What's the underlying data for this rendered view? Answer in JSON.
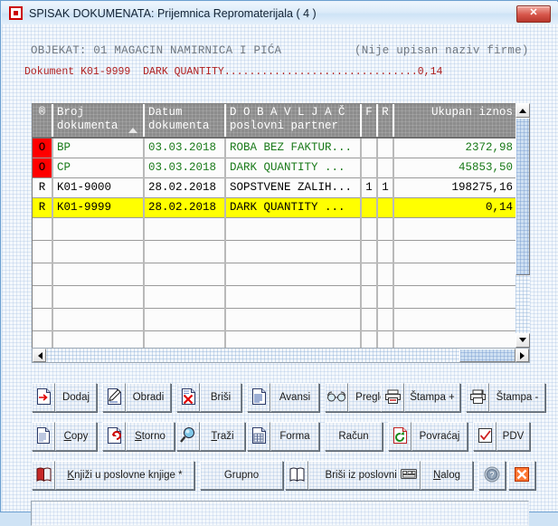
{
  "window": {
    "title_bold": "SPISAK DOKUMENATA:",
    "title_rest": "Prijemnica Repromaterijala  ( 4 )",
    "close_label": "✕",
    "app_icon": "red-square-icon"
  },
  "header": {
    "objekat": "OBJEKAT: 01 MAGACIN NAMIRNICA I PIĆA",
    "firm_note": "(Nije upisan naziv firme)",
    "document_line": "Dokument K01-9999  DARK QUANTITY...............................0,14",
    "document_color": "#b02020"
  },
  "grid": {
    "columns": [
      {
        "id": "flag",
        "label": "®",
        "label2": "",
        "align": "center"
      },
      {
        "id": "broj",
        "label": "Broj",
        "label2": "dokumenta",
        "align": "left",
        "sorted": true
      },
      {
        "id": "datum",
        "label": "Datum",
        "label2": "dokumenta",
        "align": "left"
      },
      {
        "id": "dob",
        "label": "D O B A V L J A Č",
        "label2": "poslovni partner",
        "align": "left"
      },
      {
        "id": "f",
        "label": "F",
        "label2": "",
        "align": "center"
      },
      {
        "id": "r",
        "label": "R",
        "label2": "",
        "align": "center"
      },
      {
        "id": "iznos",
        "label": "Ukupan iznos",
        "label2": "",
        "align": "right"
      }
    ],
    "rows": [
      {
        "flag": "O",
        "flag_bg": "#ff0000",
        "broj": "BP",
        "datum": "03.03.2018",
        "dob": "ROBA BEZ FAKTUR...",
        "f": "",
        "r": "",
        "iznos": "2372,98",
        "text_color": "#1a7a1a",
        "selected": false
      },
      {
        "flag": "O",
        "flag_bg": "#ff0000",
        "broj": "CP",
        "datum": "03.03.2018",
        "dob": "DARK QUANTITY   ...",
        "f": "",
        "r": "",
        "iznos": "45853,50",
        "text_color": "#1a7a1a",
        "selected": false
      },
      {
        "flag": "R",
        "flag_bg": "",
        "broj": "K01-9000",
        "datum": "28.02.2018",
        "dob": "SOPSTVENE ZALIH...",
        "f": "1",
        "r": "1",
        "iznos": "198275,16",
        "text_color": "#000000",
        "selected": false
      },
      {
        "flag": "R",
        "flag_bg": "#ffff00",
        "broj": "K01-9999",
        "datum": "28.02.2018",
        "dob": "DARK QUANTITY   ...",
        "f": "",
        "r": "",
        "iznos": "0,14",
        "text_color": "#000000",
        "selected": true
      }
    ],
    "empty_row_count": 7,
    "selection_color": "#ffff00"
  },
  "scrollbars": {
    "vertical": {
      "up_arrow": "▲",
      "down_arrow": "▼",
      "thumb_top_pct": 0,
      "thumb_size_pct": 73
    },
    "horizontal": {
      "left_arrow": "◄",
      "right_arrow": "►",
      "thumb_left_pct": 88,
      "thumb_size_pct": 12
    }
  },
  "toolbar": {
    "rows": [
      [
        {
          "icon": "document-add-icon",
          "label": "Dodaj",
          "accel": ""
        },
        {
          "icon": "document-edit-icon",
          "label": "Obradi",
          "accel": ""
        },
        {
          "icon": "document-delete-icon",
          "label": "Briši",
          "accel": ""
        },
        {
          "icon": "document-list-icon",
          "label": "Avansi",
          "accel": ""
        },
        {
          "icon": "glasses-icon",
          "label": "Pregled",
          "accel": ""
        },
        {
          "icon": "printer-plus-icon",
          "label": "Štampa +",
          "accel": ""
        },
        {
          "icon": "printer-minus-icon",
          "label": "Štampa -",
          "accel": ""
        }
      ],
      [
        {
          "icon": "document-copy-icon",
          "label": "Copy",
          "accel": "C"
        },
        {
          "icon": "document-undo-icon",
          "label": "Storno",
          "accel": "S"
        },
        {
          "icon": "magnifier-icon",
          "label": "Traži",
          "accel": "T"
        },
        {
          "icon": "form-icon",
          "label": "Forma",
          "accel": ""
        },
        {
          "icon": "",
          "label": "Račun",
          "accel": ""
        },
        {
          "icon": "document-refresh-icon",
          "label": "Povraćaj",
          "accel": ""
        },
        {
          "icon": "checkbox-check-icon",
          "label": "PDV",
          "accel": ""
        }
      ],
      [
        {
          "icon": "book-red-icon",
          "label": "Knjiži u poslovne knjige *",
          "accel": "K"
        },
        {
          "icon": "",
          "label": "Grupno",
          "accel": ""
        },
        {
          "icon": "book-open-icon",
          "label": "Briši iz poslovnih knjiga",
          "accel": ""
        },
        {
          "icon": "keyboard-icon",
          "label": "Nalog",
          "accel": "N"
        },
        {
          "icon": "help-icon",
          "label": "",
          "accel": ""
        },
        {
          "icon": "exit-icon",
          "label": "",
          "accel": ""
        }
      ]
    ]
  },
  "status": {
    "text": ""
  }
}
